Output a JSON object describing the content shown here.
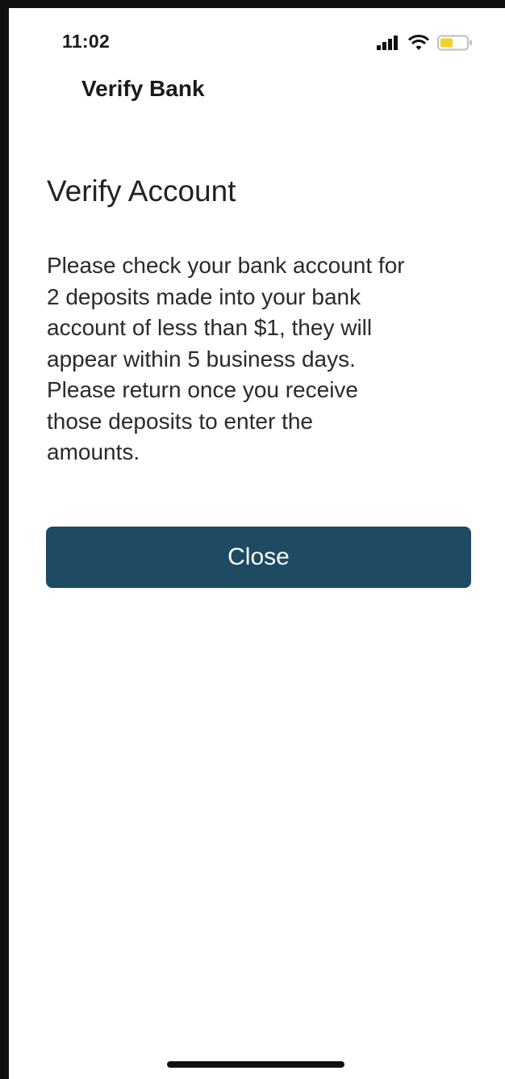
{
  "status_bar": {
    "time": "11:02",
    "icons": [
      "signal-icon",
      "wifi-icon",
      "battery-icon"
    ],
    "battery_color": "#f2d12a"
  },
  "nav": {
    "title": "Verify Bank"
  },
  "content": {
    "title": "Verify Account",
    "message_lines": [
      "Please check your bank account for",
      "2 deposits made into your bank",
      "account of less than $1, they will",
      "appear within 5 business days.",
      "Please return once you receive",
      "those deposits to enter the",
      "amounts."
    ]
  },
  "actions": {
    "close_label": "Close",
    "button_color": "#1e4a62"
  }
}
